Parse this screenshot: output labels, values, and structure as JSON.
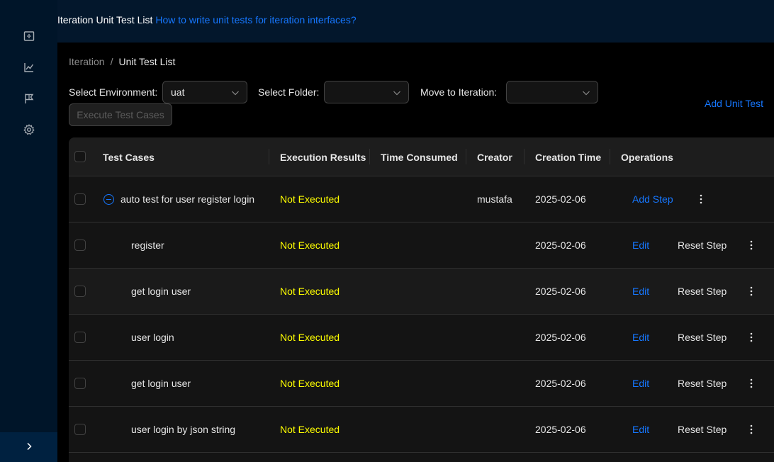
{
  "sidebar": {
    "items": [
      {
        "icon": "dashboard-icon"
      },
      {
        "icon": "line-chart-icon"
      },
      {
        "icon": "flag-icon"
      },
      {
        "icon": "gear-icon"
      }
    ],
    "toggle_icon": "chevron-right-icon"
  },
  "header": {
    "title": "Iteration Unit Test List",
    "help_link": "How to write unit tests for iteration interfaces?"
  },
  "breadcrumb": {
    "parent": "Iteration",
    "separator": "/",
    "current": "Unit Test List"
  },
  "filters": {
    "environment_label": "Select Environment:",
    "environment_value": "uat",
    "folder_label": "Select Folder:",
    "folder_value": "",
    "iteration_label": "Move to Iteration:",
    "iteration_value": ""
  },
  "toolbar": {
    "execute_label": "Execute Test Cases",
    "add_unit_test_label": "Add Unit Test"
  },
  "table": {
    "columns": [
      "Test Cases",
      "Execution Results",
      "Time Consumed",
      "Creator",
      "Creation Time",
      "Operations"
    ],
    "rows": [
      {
        "name": "auto test for user register login",
        "result": "Not Executed",
        "time_consumed": "",
        "creator": "mustafa",
        "created": "2025-02-06",
        "action1": "Add Step",
        "action2": "",
        "is_parent": true
      },
      {
        "name": "register",
        "result": "Not Executed",
        "time_consumed": "",
        "creator": "",
        "created": "2025-02-06",
        "action1": "Edit",
        "action2": "Reset Step",
        "is_parent": false
      },
      {
        "name": "get login user",
        "result": "Not Executed",
        "time_consumed": "",
        "creator": "",
        "created": "2025-02-06",
        "action1": "Edit",
        "action2": "Reset Step",
        "is_parent": false
      },
      {
        "name": "user login",
        "result": "Not Executed",
        "time_consumed": "",
        "creator": "",
        "created": "2025-02-06",
        "action1": "Edit",
        "action2": "Reset Step",
        "is_parent": false
      },
      {
        "name": "get login user",
        "result": "Not Executed",
        "time_consumed": "",
        "creator": "",
        "created": "2025-02-06",
        "action1": "Edit",
        "action2": "Reset Step",
        "is_parent": false
      },
      {
        "name": "user login by json string",
        "result": "Not Executed",
        "time_consumed": "",
        "creator": "",
        "created": "2025-02-06",
        "action1": "Edit",
        "action2": "Reset Step",
        "is_parent": false
      }
    ]
  },
  "colors": {
    "accent": "#1677ff",
    "status_not_executed": "#ffff00",
    "sidebar_bg": "#001529",
    "content_bg": "#000000"
  }
}
